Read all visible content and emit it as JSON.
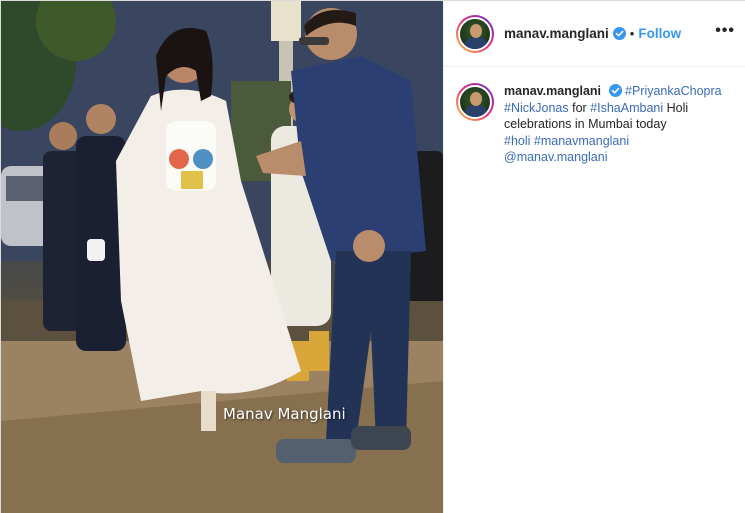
{
  "media": {
    "watermark": "Manav Manglani"
  },
  "header": {
    "username": "manav.manglani",
    "separator": "•",
    "follow_label": "Follow",
    "more_label": "•••"
  },
  "caption": {
    "username": "manav.manglani",
    "tag_priyanka": "#PriyankaChopra",
    "tag_nick": "#NickJonas",
    "text_for": " for ",
    "tag_isha": "#IshaAmbani",
    "text_rest": " Holi celebrations in Mumbai today",
    "tag_holi": "#holi",
    "tag_manav": "#manavmanglani",
    "mention": "@manav.manglani"
  },
  "colors": {
    "link": "#3c6bb4",
    "follow": "#3897f0",
    "verified": "#3897f0"
  },
  "icons": {
    "verified": "verified-badge-icon",
    "more": "more-options-icon"
  }
}
